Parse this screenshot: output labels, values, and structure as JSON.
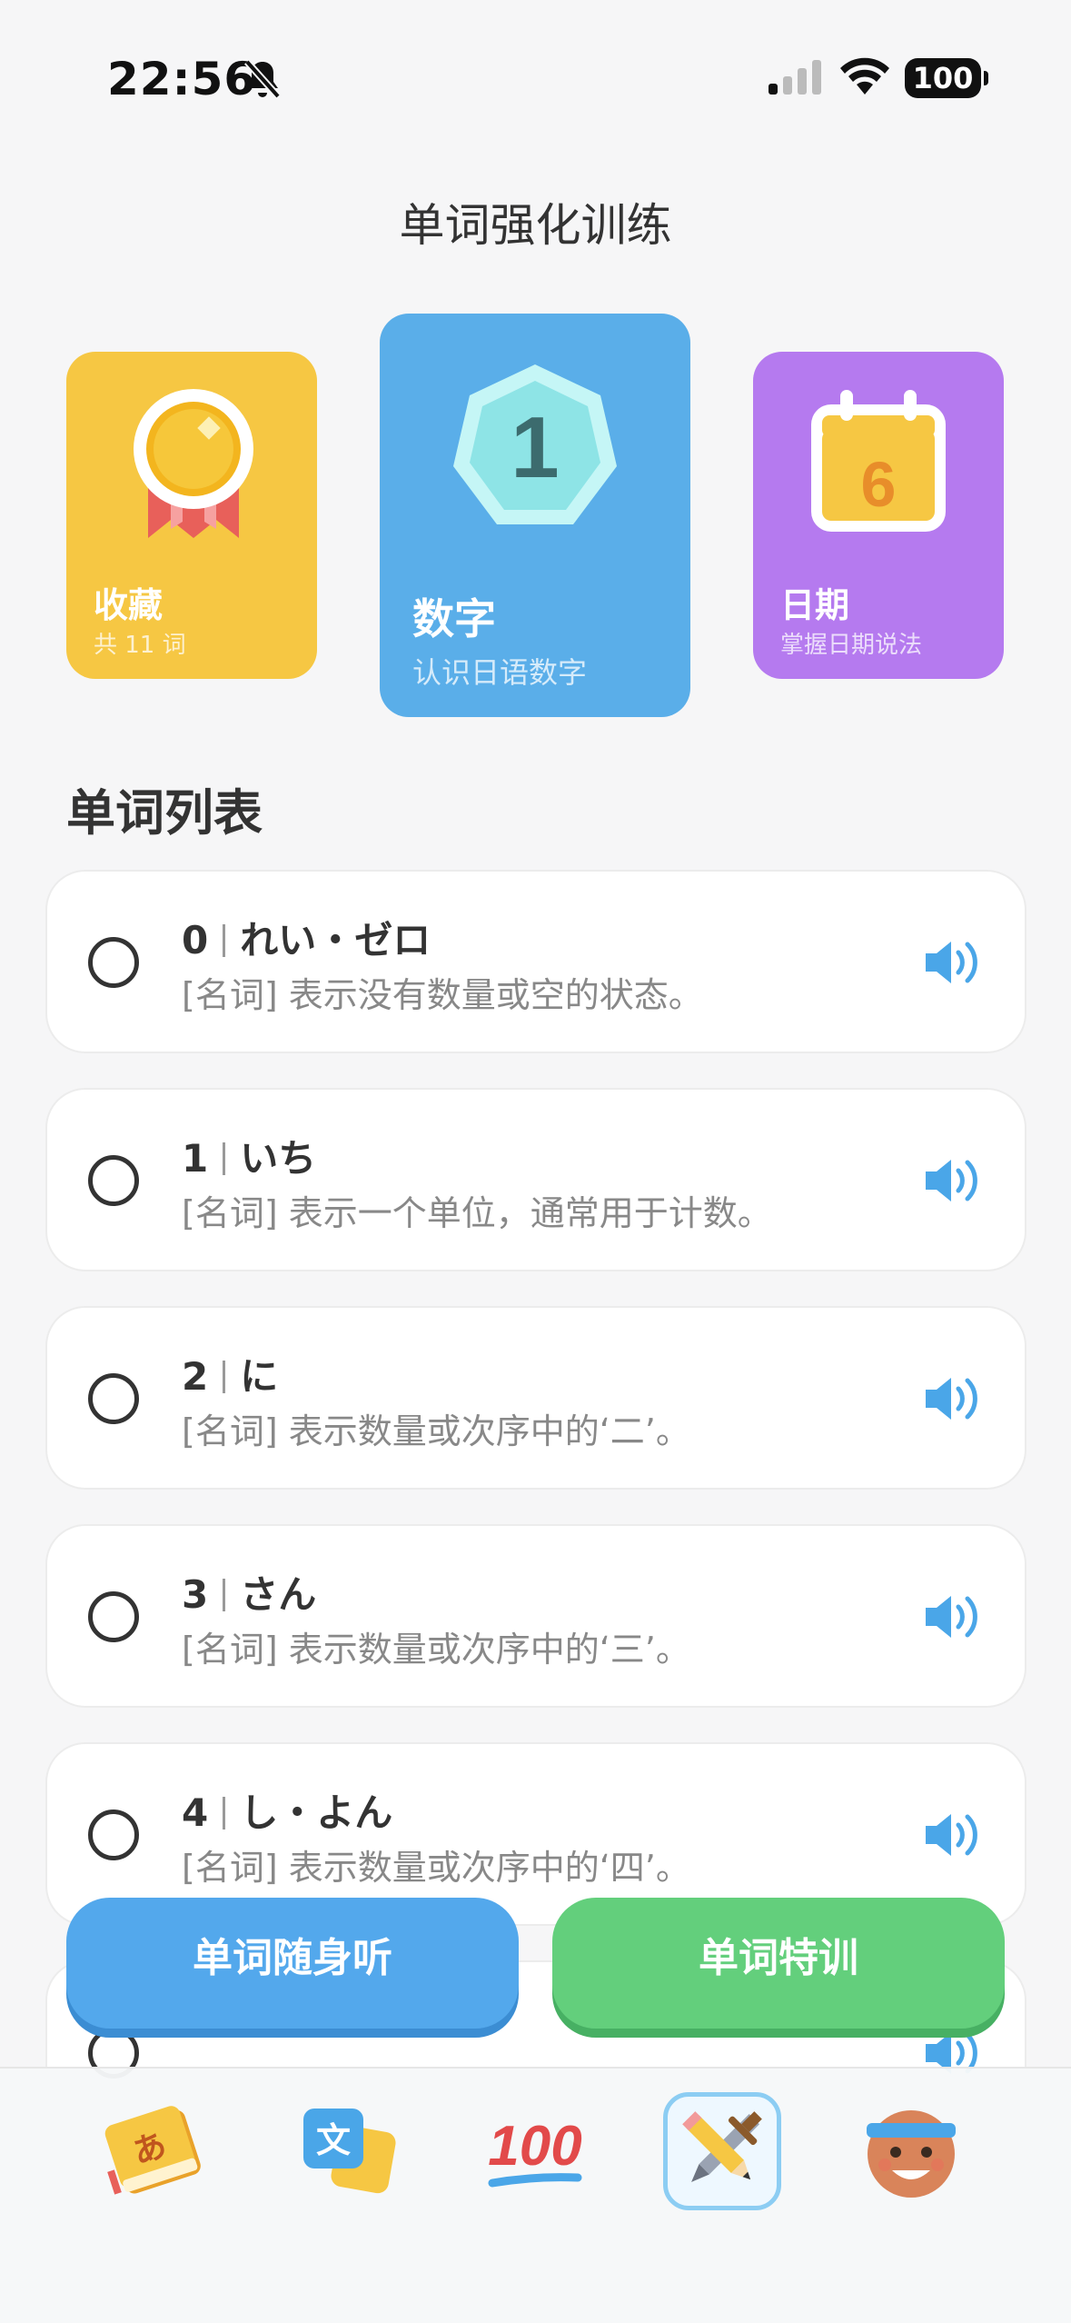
{
  "status": {
    "time": "22:56",
    "battery": "100"
  },
  "page_title": "单词强化训练",
  "cards": {
    "favorites": {
      "title": "收藏",
      "subtitle": "共 11 词"
    },
    "numbers": {
      "title": "数字",
      "subtitle": "认识日语数字",
      "badge": "1"
    },
    "dates": {
      "title": "日期",
      "subtitle": "掌握日期说法",
      "badge": "6"
    }
  },
  "section_title": "单词列表",
  "words": [
    {
      "word": "0",
      "reading": "れい・ゼロ",
      "desc": "[名词] 表示没有数量或空的状态。"
    },
    {
      "word": "1",
      "reading": "いち",
      "desc": "[名词] 表示一个单位，通常用于计数。"
    },
    {
      "word": "2",
      "reading": "に",
      "desc": "[名词] 表示数量或次序中的‘二’。"
    },
    {
      "word": "3",
      "reading": "さん",
      "desc": "[名词] 表示数量或次序中的‘三’。"
    },
    {
      "word": "4",
      "reading": "し・よん",
      "desc": "[名词] 表示数量或次序中的‘四’。"
    }
  ],
  "buttons": {
    "listen": "单词随身听",
    "train": "单词特训"
  },
  "tabbar": {
    "items": [
      {
        "icon": "japanese-book-icon"
      },
      {
        "icon": "translate-icon"
      },
      {
        "icon": "hundred-points-icon"
      },
      {
        "icon": "pencil-sword-icon",
        "selected": true
      },
      {
        "icon": "avatar-icon"
      }
    ]
  },
  "colors": {
    "fav": "#f6c743",
    "num": "#5aaee9",
    "date": "#b57aef",
    "listen": "#53a8ec",
    "train": "#63cf7c"
  }
}
